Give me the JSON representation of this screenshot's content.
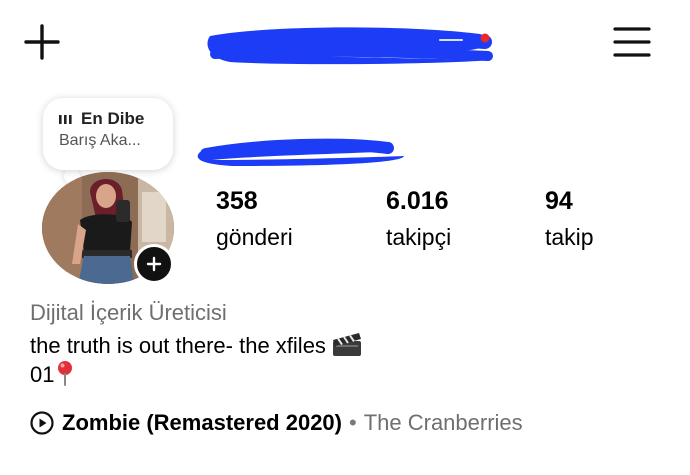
{
  "header": {
    "create_icon": "plus-icon",
    "menu_icon": "hamburger-menu-icon",
    "redaction_color": "#1c3cf5"
  },
  "note": {
    "title": "En Dibe",
    "subtitle": "Barış Aka..."
  },
  "profile": {
    "add_story_icon": "plus-icon"
  },
  "stats": [
    {
      "value": "358",
      "label": "gönderi"
    },
    {
      "value": "6.016",
      "label": "takipçi"
    },
    {
      "value": "94",
      "label": "takip"
    }
  ],
  "bio": {
    "category": "Dijital İçerik Üreticisi",
    "line1": "the truth is out there- the xfiles",
    "line2": "01"
  },
  "music": {
    "title": "Zombie (Remastered 2020)",
    "separator": "•",
    "artist": "The Cranberries"
  }
}
